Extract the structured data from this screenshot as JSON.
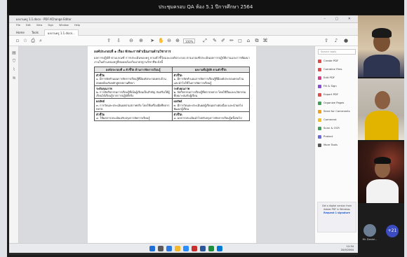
{
  "meeting": {
    "title": "ประชุมครอบ QA ห้อง 5.1 ปีการศึกษา 2564"
  },
  "window": {
    "title": "ผลงานครู 1.1.docx - PDF-XChange Editor",
    "controls": "–  ▢  ✕"
  },
  "menu": {
    "items": [
      "File",
      "Edit",
      "View",
      "Sign",
      "Window",
      "Help"
    ]
  },
  "tabs": [
    {
      "label": "Home"
    },
    {
      "label": "Tools"
    },
    {
      "label": "ผลงานครู 1.1.docx..."
    }
  ],
  "toolbar": {
    "zoom": "100%"
  },
  "document": {
    "heading": "องค์ประกอบที่ ๑ เรื่อง ทักษะการดำเนินงานด้านวิชาการ",
    "intro": "ผลการปฏิบัติ ตามเกณฑ์ การประเมินของครู ตามตัวชี้วัดและองค์ประกอบ ตามเกณฑ์ประเมินผลการปฏิบัติงานและการพัฒนางานในตำแหน่งครูที่สอดคล้องกับมาตรฐานวิชาชีพ ดังนี้",
    "table": {
      "headers": [
        "องค์ประกอบที่ ๑ ตัวชี้วัด ด้านการจัดการเรียนรู้",
        "ผลงานที่ปฏิบัติ ตามตัวชี้วัด"
      ],
      "rows": [
        [
          "ตัวชี้วัด",
          "ตัวชี้วัด"
        ],
        [
          "๑. มีการจัดทำแผนการจัดการเรียนรู้ที่มีองค์ประกอบครบถ้วน สอดคล้องกับหลักสูตรสถานศึกษา",
          "๑. มีการจัดทำแผนการจัดการเรียนรู้ที่มีองค์ประกอบครบถ้วน และนำไปใช้ในการจัดการเรียนรู้"
        ],
        [
          "ระดับคุณภาพ",
          "ระดับคุณภาพ"
        ],
        [
          "๒. การจัดกิจกรรมการเรียนรู้ที่เน้นผู้เรียนเป็นสำคัญ ส่งเสริมให้ผู้เรียนได้เรียนรู้จากการปฏิบัติจริง",
          "๒. จัดกิจกรรมการเรียนรู้ที่หลากหลาย โดยใช้สื่อและนวัตกรรมที่เหมาะสมกับผู้เรียน"
        ],
        [
          "ผลลัพธ์",
          "ผลลัพธ์"
        ],
        [
          "๓. การวัดและประเมินผลตามสภาพจริง โดยใช้เครื่องมือที่หลากหลาย",
          "๓. มีการวัดและประเมินผลผู้เรียนอย่างต่อเนื่อง และนำผลไปพัฒนาผู้เรียน"
        ],
        [
          "ตัวชี้วัด",
          "ตัวชี้วัด"
        ],
        [
          "๔. ใช้ผลการประเมินปรับปรุงการจัดการเรียนรู้",
          "๔. ผลการประเมินนำไปปรับปรุงการจัดการเรียนรู้ครั้งต่อไป"
        ]
      ]
    }
  },
  "tools_panel": {
    "search_placeholder": "Search tools",
    "items": [
      {
        "label": "Create PDF",
        "color": "#e04b4b"
      },
      {
        "label": "Combine Files",
        "color": "#e04b4b"
      },
      {
        "label": "Edit PDF",
        "color": "#d33c8a"
      },
      {
        "label": "Fill & Sign",
        "color": "#8b4ad8"
      },
      {
        "label": "Export PDF",
        "color": "#e04b4b"
      },
      {
        "label": "Organize Pages",
        "color": "#3fa05b"
      },
      {
        "label": "Send for Comments",
        "color": "#f0a020"
      },
      {
        "label": "Comment",
        "color": "#f0c020"
      },
      {
        "label": "Scan & OCR",
        "color": "#3fa05b"
      },
      {
        "label": "Protect",
        "color": "#6a6ad8"
      },
      {
        "label": "More Tools",
        "color": "#555555"
      }
    ],
    "promo_line1": "Get a digital version from",
    "promo_line2": "Adobe PDF in Windows",
    "promo_link": "Request 1 signature"
  },
  "taskbar": {
    "time": "12:34",
    "date": "20/9/2564"
  },
  "self_view": {
    "name": "Mr. Daniel...",
    "more": "+21"
  }
}
